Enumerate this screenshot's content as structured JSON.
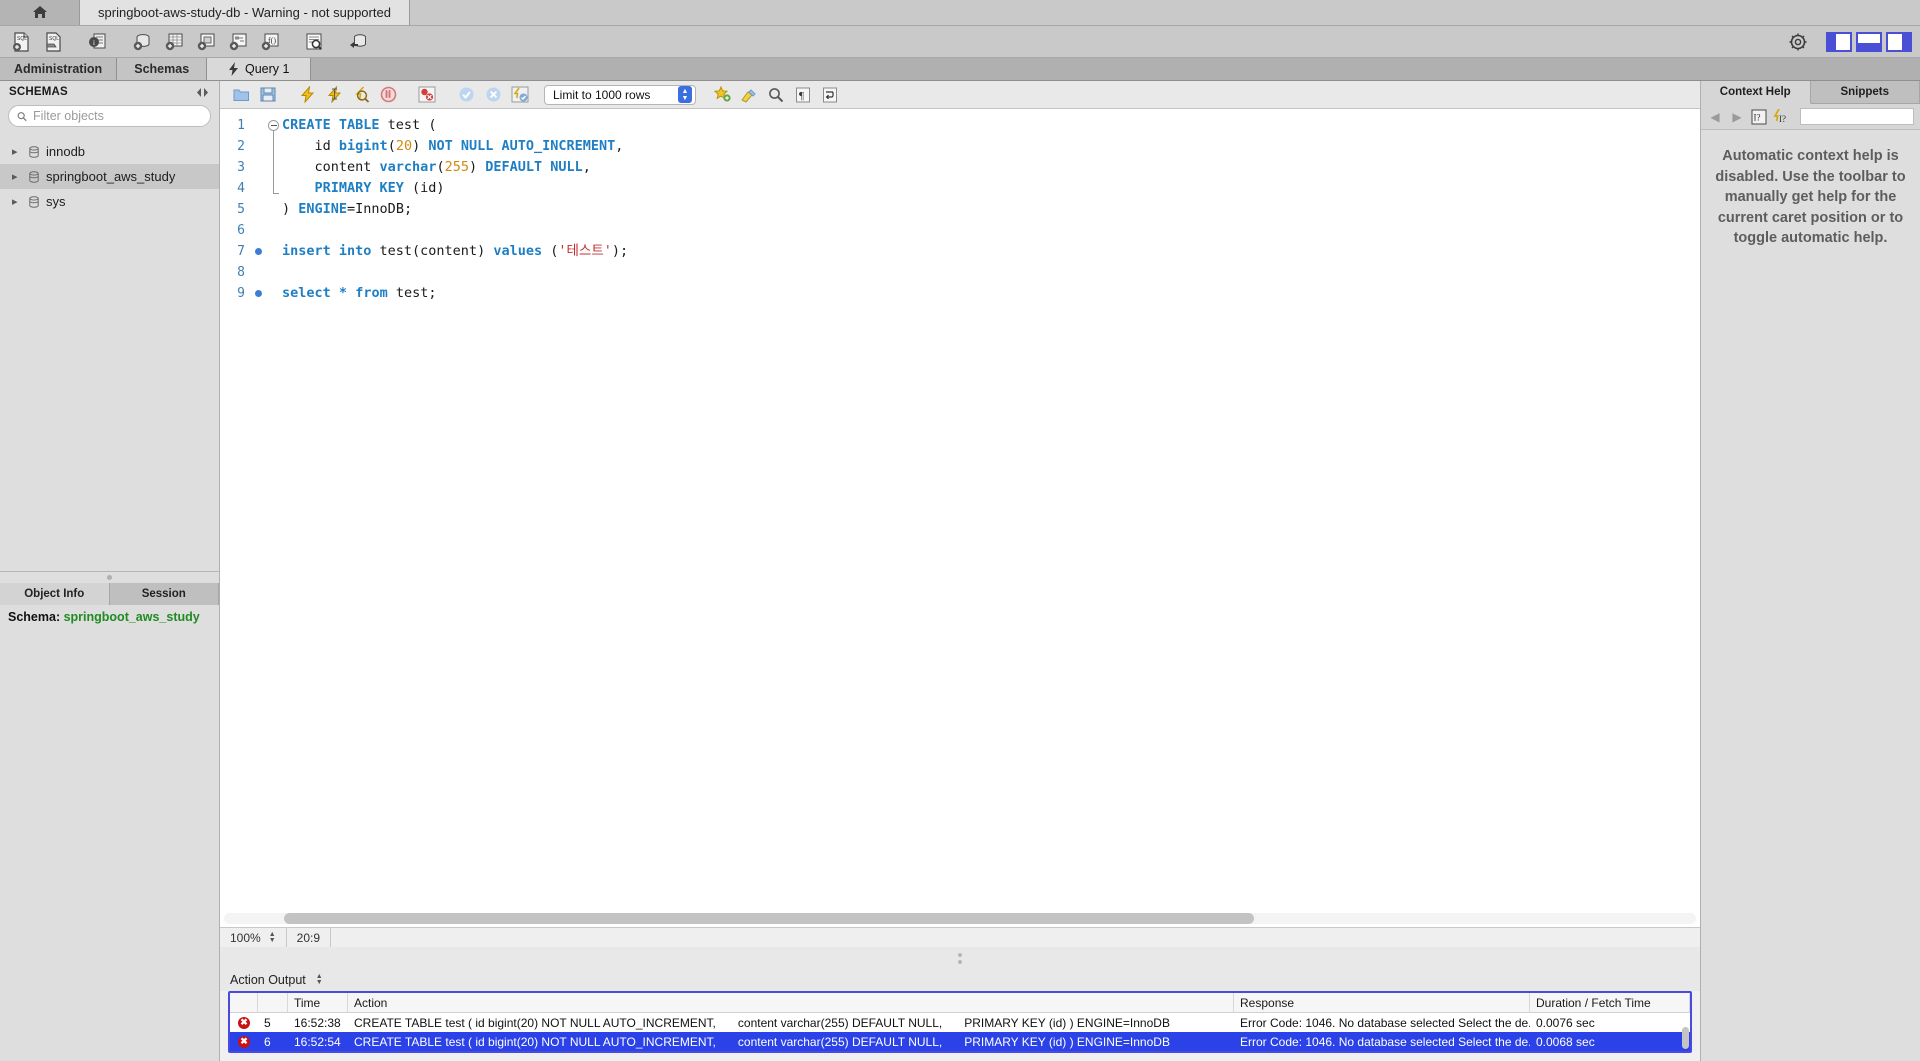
{
  "window": {
    "home_icon": "home-icon",
    "tab_title": "springboot-aws-study-db - Warning - not supported"
  },
  "main_toolbar": {
    "buttons": [
      {
        "name": "new-sql-tab-icon",
        "label": "SQL"
      },
      {
        "name": "open-sql-script-icon",
        "label": "SQL"
      },
      {
        "name": "server-info-icon",
        "label": "i"
      },
      {
        "name": "create-schema-icon",
        "label": "+"
      },
      {
        "name": "create-table-icon",
        "label": "+"
      },
      {
        "name": "create-view-icon",
        "label": "+"
      },
      {
        "name": "create-procedure-icon",
        "label": "+"
      },
      {
        "name": "create-function-icon",
        "label": "+"
      },
      {
        "name": "inspect-schema-icon",
        "label": "Q"
      },
      {
        "name": "reconnect-server-icon",
        "label": "DB"
      }
    ],
    "right_icons": [
      {
        "name": "gear-icon"
      },
      {
        "name": "toggle-left-sidebar-icon"
      },
      {
        "name": "toggle-bottom-panel-icon"
      },
      {
        "name": "toggle-right-sidebar-icon"
      }
    ]
  },
  "tabs": [
    {
      "label": "Administration",
      "active": false
    },
    {
      "label": "Schemas",
      "active": false
    },
    {
      "label": "Query 1",
      "active": true,
      "icon": "lightning-icon"
    }
  ],
  "sidebar": {
    "header": "SCHEMAS",
    "collapse_icon": "collapse-icon",
    "search": {
      "placeholder": "Filter objects",
      "value": "",
      "icon": "search-icon"
    },
    "items": [
      {
        "label": "innodb",
        "selected": false
      },
      {
        "label": "springboot_aws_study",
        "selected": true
      },
      {
        "label": "sys",
        "selected": false
      }
    ],
    "bottom_tabs": [
      {
        "label": "Object Info",
        "active": true
      },
      {
        "label": "Session",
        "active": false
      }
    ],
    "object_info": {
      "key": "Schema:",
      "value": "springboot_aws_study"
    }
  },
  "editor_toolbar": {
    "buttons": [
      {
        "name": "open-file-icon"
      },
      {
        "name": "save-file-icon"
      },
      {
        "name": "execute-statement-icon"
      },
      {
        "name": "execute-current-statement-icon"
      },
      {
        "name": "explain-query-icon"
      },
      {
        "name": "stop-execution-icon"
      },
      {
        "name": "toggle-stop-on-error-icon"
      },
      {
        "name": "commit-icon"
      },
      {
        "name": "rollback-icon"
      },
      {
        "name": "toggle-autocommit-icon"
      }
    ],
    "limit_select": {
      "value": "Limit to 1000 rows"
    },
    "right_buttons": [
      {
        "name": "toggle-snippet-icon"
      },
      {
        "name": "beautify-query-icon"
      },
      {
        "name": "find-icon"
      },
      {
        "name": "toggle-invisible-chars-icon"
      },
      {
        "name": "toggle-wrapping-icon"
      }
    ]
  },
  "code": {
    "lines": [
      {
        "num": 1,
        "breakpoint": false,
        "tokens": [
          {
            "t": "CREATE TABLE",
            "c": "kw"
          },
          {
            "t": " test (",
            "c": "plain"
          }
        ]
      },
      {
        "num": 2,
        "breakpoint": false,
        "tokens": [
          {
            "t": "    id ",
            "c": "plain"
          },
          {
            "t": "bigint",
            "c": "kw"
          },
          {
            "t": "(",
            "c": "plain"
          },
          {
            "t": "20",
            "c": "num"
          },
          {
            "t": ") ",
            "c": "plain"
          },
          {
            "t": "NOT NULL AUTO_INCREMENT",
            "c": "kw"
          },
          {
            "t": ",",
            "c": "plain"
          }
        ]
      },
      {
        "num": 3,
        "breakpoint": false,
        "tokens": [
          {
            "t": "    content ",
            "c": "plain"
          },
          {
            "t": "varchar",
            "c": "kw"
          },
          {
            "t": "(",
            "c": "plain"
          },
          {
            "t": "255",
            "c": "num"
          },
          {
            "t": ") ",
            "c": "plain"
          },
          {
            "t": "DEFAULT NULL",
            "c": "kw"
          },
          {
            "t": ",",
            "c": "plain"
          }
        ]
      },
      {
        "num": 4,
        "breakpoint": false,
        "tokens": [
          {
            "t": "    ",
            "c": "plain"
          },
          {
            "t": "PRIMARY KEY",
            "c": "kw"
          },
          {
            "t": " (id)",
            "c": "plain"
          }
        ]
      },
      {
        "num": 5,
        "breakpoint": false,
        "tokens": [
          {
            "t": ") ",
            "c": "plain"
          },
          {
            "t": "ENGINE",
            "c": "kw"
          },
          {
            "t": "=InnoDB;",
            "c": "plain"
          }
        ]
      },
      {
        "num": 6,
        "breakpoint": false,
        "tokens": []
      },
      {
        "num": 7,
        "breakpoint": true,
        "tokens": [
          {
            "t": "insert into",
            "c": "kw"
          },
          {
            "t": " test(content) ",
            "c": "plain"
          },
          {
            "t": "values",
            "c": "kw"
          },
          {
            "t": " (",
            "c": "plain"
          },
          {
            "t": "'테스트'",
            "c": "str"
          },
          {
            "t": ");",
            "c": "plain"
          }
        ]
      },
      {
        "num": 8,
        "breakpoint": false,
        "tokens": []
      },
      {
        "num": 9,
        "breakpoint": true,
        "tokens": [
          {
            "t": "select",
            "c": "kw"
          },
          {
            "t": " ",
            "c": "plain"
          },
          {
            "t": "*",
            "c": "kw"
          },
          {
            "t": " ",
            "c": "plain"
          },
          {
            "t": "from",
            "c": "kw"
          },
          {
            "t": " test;",
            "c": "plain"
          }
        ]
      }
    ]
  },
  "status_bar": {
    "zoom": "100%",
    "caret": "20:9"
  },
  "output": {
    "panel_label": "Action Output",
    "columns": [
      "",
      "",
      "Time",
      "Action",
      "Response",
      "Duration / Fetch Time"
    ],
    "rows": [
      {
        "status": "error",
        "num": "5",
        "time": "16:52:38",
        "action_1": "CREATE TABLE test (  id bigint(20) NOT NULL AUTO_INCREMENT,",
        "action_2": "content varchar(255) DEFAULT NULL,",
        "action_3": "PRIMARY KEY (id) ) ENGINE=InnoDB",
        "response": "Error Code: 1046. No database selected Select the de...",
        "duration": "0.0076 sec",
        "selected": false
      },
      {
        "status": "error",
        "num": "6",
        "time": "16:52:54",
        "action_1": "CREATE TABLE test (  id bigint(20) NOT NULL AUTO_INCREMENT,",
        "action_2": "content varchar(255) DEFAULT NULL,",
        "action_3": "PRIMARY KEY (id) ) ENGINE=InnoDB",
        "response": "Error Code: 1046. No database selected Select the de...",
        "duration": "0.0068 sec",
        "selected": true
      }
    ]
  },
  "right_panel": {
    "tabs": [
      {
        "label": "Context Help",
        "active": true
      },
      {
        "label": "Snippets",
        "active": false
      }
    ],
    "toolbar": {
      "back_icon": "back-arrow-icon",
      "forward_icon": "forward-arrow-icon",
      "help_icon": "context-help-icon",
      "auto_help_icon": "auto-context-help-icon",
      "search_value": ""
    },
    "help_text": "Automatic context help is disabled. Use the toolbar to manually get help for the current caret position or to toggle automatic help."
  },
  "colors": {
    "accent_blue": "#2b42e8",
    "keyword": "#1f7fc4",
    "number": "#d08a10",
    "string": "#c03030",
    "error_red": "#cc1111",
    "schema_green": "#1f8b20"
  }
}
